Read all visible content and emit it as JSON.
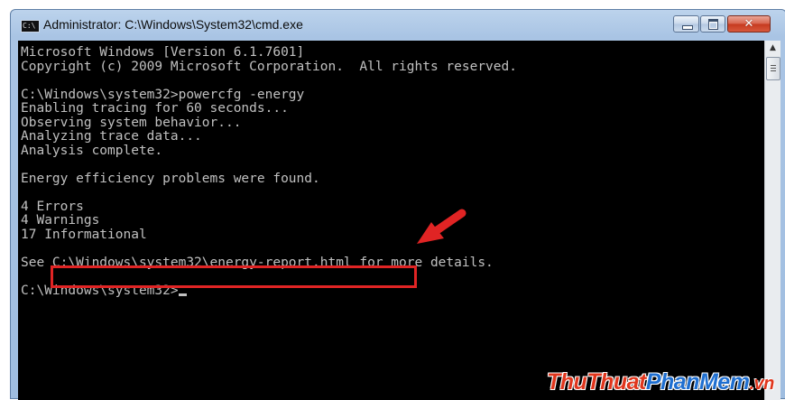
{
  "window": {
    "title": "Administrator: C:\\Windows\\System32\\cmd.exe",
    "icon": "cmd-icon"
  },
  "console": {
    "lines": [
      "Microsoft Windows [Version 6.1.7601]",
      "Copyright (c) 2009 Microsoft Corporation.  All rights reserved.",
      "",
      "C:\\Windows\\system32>powercfg -energy",
      "Enabling tracing for 60 seconds...",
      "Observing system behavior...",
      "Analyzing trace data...",
      "Analysis complete.",
      "",
      "Energy efficiency problems were found.",
      "",
      "4 Errors",
      "4 Warnings",
      "17 Informational",
      "",
      "See C:\\Windows\\system32\\energy-report.html for more details.",
      "",
      "C:\\Windows\\system32>"
    ],
    "text_color": "#c0c0c0",
    "background": "#000000"
  },
  "annotation": {
    "highlighted_text": "C:\\Windows\\system32\\energy-report.html",
    "color": "#e02424"
  },
  "watermark": {
    "part1": "ThuThuat",
    "part2": "PhanMem",
    "part3": ".vn"
  }
}
